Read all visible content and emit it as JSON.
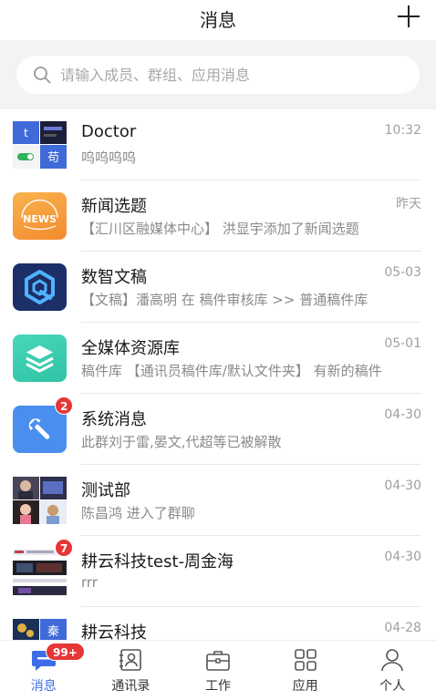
{
  "header": {
    "title": "消息"
  },
  "search": {
    "placeholder": "请输入成员、群组、应用消息"
  },
  "conversations": [
    {
      "name": "Doctor",
      "time": "10:32",
      "preview": "呜呜呜呜",
      "avatar_type": "group-collage",
      "avatar_chars": [
        "t",
        "苟"
      ]
    },
    {
      "name": "新闻选题",
      "time": "昨天",
      "preview": "【汇川区融媒体中心】 洪显宇添加了新闻选题",
      "avatar_type": "app",
      "avatar_text": "NEWS",
      "color": "#f6a33d"
    },
    {
      "name": "数智文稿",
      "time": "05-03",
      "preview": "【文稿】潘高明 在 稿件审核库 >> 普通稿件库",
      "avatar_type": "app",
      "color": "#1c2f66"
    },
    {
      "name": "全媒体资源库",
      "time": "05-01",
      "preview": "稿件库 【通讯员稿件库/默认文件夹】 有新的稿件",
      "avatar_type": "app",
      "color": "#3bcfb0"
    },
    {
      "name": "系统消息",
      "time": "04-30",
      "preview": "此群刘于雷,晏文,代超等已被解散",
      "avatar_type": "app",
      "color": "#4a8ef0",
      "badge": "2"
    },
    {
      "name": "测试部",
      "time": "04-30",
      "preview": "陈昌鸿 进入了群聊",
      "avatar_type": "photo-collage"
    },
    {
      "name": "耕云科技test-周金海",
      "time": "04-30",
      "preview": "rrr",
      "avatar_type": "screenshot-collage",
      "badge": "7"
    },
    {
      "name": "耕云科技",
      "time": "04-28",
      "preview": "",
      "avatar_type": "photo-collage",
      "avatar_chars": [
        "秦"
      ]
    }
  ],
  "tabbar": [
    {
      "label": "消息",
      "icon": "chat-bubble-icon",
      "active": true,
      "badge": "99+"
    },
    {
      "label": "通讯录",
      "icon": "contacts-book-icon",
      "active": false
    },
    {
      "label": "工作",
      "icon": "briefcase-icon",
      "active": false
    },
    {
      "label": "应用",
      "icon": "apps-grid-icon",
      "active": false
    },
    {
      "label": "个人",
      "icon": "person-icon",
      "active": false
    }
  ],
  "colors": {
    "accent": "#3d6ee8",
    "badge": "#e63636",
    "search_bg": "#f2f3f5"
  }
}
